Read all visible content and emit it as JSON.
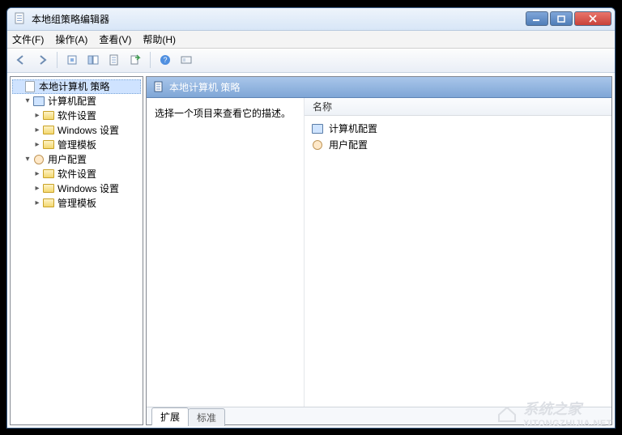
{
  "window": {
    "title": "本地组策略编辑器"
  },
  "menu": {
    "file": "文件(F)",
    "action": "操作(A)",
    "view": "查看(V)",
    "help": "帮助(H)"
  },
  "tree": {
    "root": "本地计算机 策略",
    "computer": "计算机配置",
    "user": "用户配置",
    "soft": "软件设置",
    "win": "Windows 设置",
    "tpl": "管理模板"
  },
  "right": {
    "header": "本地计算机 策略",
    "desc": "选择一个项目来查看它的描述。",
    "col_name": "名称",
    "items": {
      "computer": "计算机配置",
      "user": "用户配置"
    }
  },
  "tabs": {
    "ext": "扩展",
    "std": "标准"
  },
  "watermark": {
    "brand": "系统之家",
    "url": "XITONGZHIJIA.NET"
  }
}
